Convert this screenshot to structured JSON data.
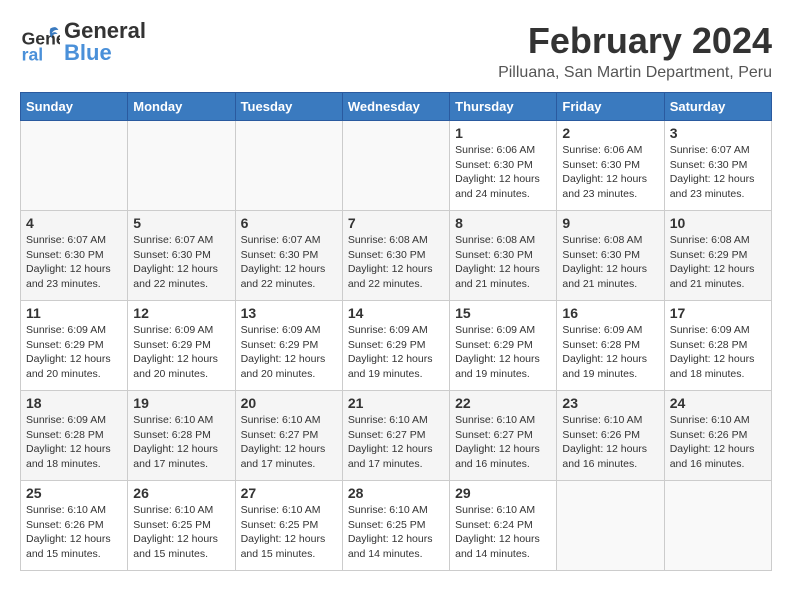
{
  "app": {
    "name_general": "General",
    "name_blue": "Blue",
    "month": "February 2024",
    "location": "Pilluana, San Martin Department, Peru"
  },
  "calendar": {
    "headers": [
      "Sunday",
      "Monday",
      "Tuesday",
      "Wednesday",
      "Thursday",
      "Friday",
      "Saturday"
    ],
    "weeks": [
      [
        {
          "day": "",
          "info": ""
        },
        {
          "day": "",
          "info": ""
        },
        {
          "day": "",
          "info": ""
        },
        {
          "day": "",
          "info": ""
        },
        {
          "day": "1",
          "info": "Sunrise: 6:06 AM\nSunset: 6:30 PM\nDaylight: 12 hours\nand 24 minutes."
        },
        {
          "day": "2",
          "info": "Sunrise: 6:06 AM\nSunset: 6:30 PM\nDaylight: 12 hours\nand 23 minutes."
        },
        {
          "day": "3",
          "info": "Sunrise: 6:07 AM\nSunset: 6:30 PM\nDaylight: 12 hours\nand 23 minutes."
        }
      ],
      [
        {
          "day": "4",
          "info": "Sunrise: 6:07 AM\nSunset: 6:30 PM\nDaylight: 12 hours\nand 23 minutes."
        },
        {
          "day": "5",
          "info": "Sunrise: 6:07 AM\nSunset: 6:30 PM\nDaylight: 12 hours\nand 22 minutes."
        },
        {
          "day": "6",
          "info": "Sunrise: 6:07 AM\nSunset: 6:30 PM\nDaylight: 12 hours\nand 22 minutes."
        },
        {
          "day": "7",
          "info": "Sunrise: 6:08 AM\nSunset: 6:30 PM\nDaylight: 12 hours\nand 22 minutes."
        },
        {
          "day": "8",
          "info": "Sunrise: 6:08 AM\nSunset: 6:30 PM\nDaylight: 12 hours\nand 21 minutes."
        },
        {
          "day": "9",
          "info": "Sunrise: 6:08 AM\nSunset: 6:30 PM\nDaylight: 12 hours\nand 21 minutes."
        },
        {
          "day": "10",
          "info": "Sunrise: 6:08 AM\nSunset: 6:29 PM\nDaylight: 12 hours\nand 21 minutes."
        }
      ],
      [
        {
          "day": "11",
          "info": "Sunrise: 6:09 AM\nSunset: 6:29 PM\nDaylight: 12 hours\nand 20 minutes."
        },
        {
          "day": "12",
          "info": "Sunrise: 6:09 AM\nSunset: 6:29 PM\nDaylight: 12 hours\nand 20 minutes."
        },
        {
          "day": "13",
          "info": "Sunrise: 6:09 AM\nSunset: 6:29 PM\nDaylight: 12 hours\nand 20 minutes."
        },
        {
          "day": "14",
          "info": "Sunrise: 6:09 AM\nSunset: 6:29 PM\nDaylight: 12 hours\nand 19 minutes."
        },
        {
          "day": "15",
          "info": "Sunrise: 6:09 AM\nSunset: 6:29 PM\nDaylight: 12 hours\nand 19 minutes."
        },
        {
          "day": "16",
          "info": "Sunrise: 6:09 AM\nSunset: 6:28 PM\nDaylight: 12 hours\nand 19 minutes."
        },
        {
          "day": "17",
          "info": "Sunrise: 6:09 AM\nSunset: 6:28 PM\nDaylight: 12 hours\nand 18 minutes."
        }
      ],
      [
        {
          "day": "18",
          "info": "Sunrise: 6:09 AM\nSunset: 6:28 PM\nDaylight: 12 hours\nand 18 minutes."
        },
        {
          "day": "19",
          "info": "Sunrise: 6:10 AM\nSunset: 6:28 PM\nDaylight: 12 hours\nand 17 minutes."
        },
        {
          "day": "20",
          "info": "Sunrise: 6:10 AM\nSunset: 6:27 PM\nDaylight: 12 hours\nand 17 minutes."
        },
        {
          "day": "21",
          "info": "Sunrise: 6:10 AM\nSunset: 6:27 PM\nDaylight: 12 hours\nand 17 minutes."
        },
        {
          "day": "22",
          "info": "Sunrise: 6:10 AM\nSunset: 6:27 PM\nDaylight: 12 hours\nand 16 minutes."
        },
        {
          "day": "23",
          "info": "Sunrise: 6:10 AM\nSunset: 6:26 PM\nDaylight: 12 hours\nand 16 minutes."
        },
        {
          "day": "24",
          "info": "Sunrise: 6:10 AM\nSunset: 6:26 PM\nDaylight: 12 hours\nand 16 minutes."
        }
      ],
      [
        {
          "day": "25",
          "info": "Sunrise: 6:10 AM\nSunset: 6:26 PM\nDaylight: 12 hours\nand 15 minutes."
        },
        {
          "day": "26",
          "info": "Sunrise: 6:10 AM\nSunset: 6:25 PM\nDaylight: 12 hours\nand 15 minutes."
        },
        {
          "day": "27",
          "info": "Sunrise: 6:10 AM\nSunset: 6:25 PM\nDaylight: 12 hours\nand 15 minutes."
        },
        {
          "day": "28",
          "info": "Sunrise: 6:10 AM\nSunset: 6:25 PM\nDaylight: 12 hours\nand 14 minutes."
        },
        {
          "day": "29",
          "info": "Sunrise: 6:10 AM\nSunset: 6:24 PM\nDaylight: 12 hours\nand 14 minutes."
        },
        {
          "day": "",
          "info": ""
        },
        {
          "day": "",
          "info": ""
        }
      ]
    ]
  }
}
